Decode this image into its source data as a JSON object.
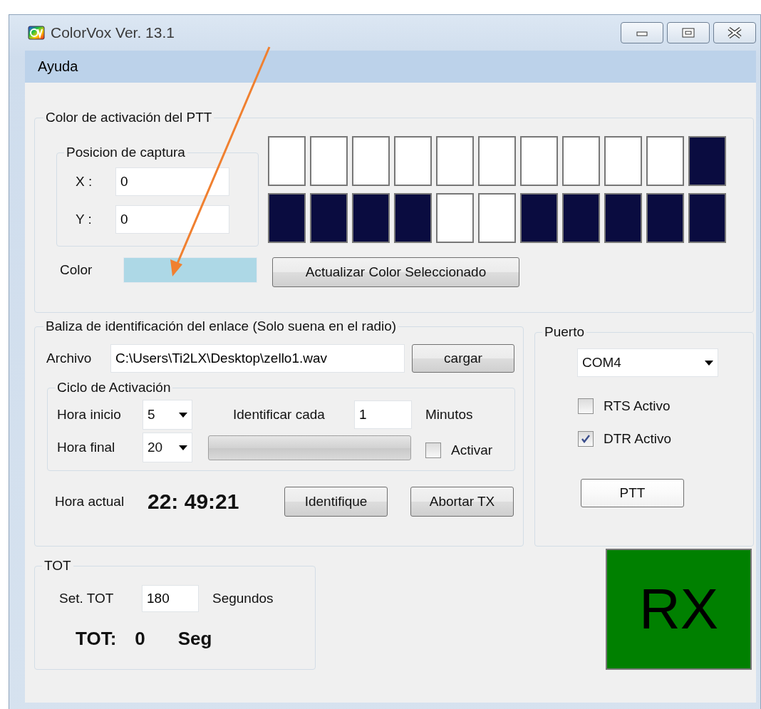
{
  "window": {
    "title": "ColorVox  Ver. 13.1"
  },
  "menu": [
    {
      "label": "Ayuda"
    }
  ],
  "ptt_color": {
    "title": "Color de activación del PTT",
    "capture": {
      "title": "Posicion de captura",
      "fields": [
        {
          "label": "X :",
          "value": "0"
        },
        {
          "label": "Y :",
          "value": "0"
        }
      ]
    },
    "color_label": "Color",
    "color": "#add8e6",
    "swatches": [
      [
        {
          "color": "#ffffff"
        },
        {
          "color": "#ffffff"
        },
        {
          "color": "#ffffff"
        },
        {
          "color": "#ffffff"
        },
        {
          "color": "#ffffff"
        },
        {
          "color": "#ffffff"
        },
        {
          "color": "#ffffff"
        },
        {
          "color": "#ffffff"
        },
        {
          "color": "#ffffff"
        },
        {
          "color": "#ffffff"
        },
        {
          "color": "#0a0c40"
        }
      ],
      [
        {
          "color": "#0a0c40"
        },
        {
          "color": "#0a0c40"
        },
        {
          "color": "#0a0c40"
        },
        {
          "color": "#0a0c40"
        },
        {
          "color": "#ffffff"
        },
        {
          "color": "#ffffff"
        },
        {
          "color": "#0a0c40"
        },
        {
          "color": "#0a0c40"
        },
        {
          "color": "#0a0c40"
        },
        {
          "color": "#0a0c40"
        },
        {
          "color": "#0a0c40"
        }
      ]
    ],
    "update_button": "Actualizar Color Seleccionado"
  },
  "beacon": {
    "title": "Baliza de identificación del enlace (Solo suena en el radio)",
    "file_label": "Archivo",
    "file_value": "C:\\Users\\Ti2LX\\Desktop\\zello1.wav",
    "load_button": "cargar",
    "cycle": {
      "title": "Ciclo de Activación",
      "start_label": "Hora inicio",
      "start_value": "5",
      "end_label": "Hora final",
      "end_value": "20",
      "every_label": "Identificar cada",
      "every_value": "1",
      "unit": "Minutos",
      "progress": {
        "level": 0
      },
      "activate": {
        "label": "Activar",
        "checked": false
      }
    },
    "time_label": "Hora actual",
    "time": "22: 49:21",
    "buttons": [
      "Identifique",
      "Abortar TX"
    ]
  },
  "port": {
    "title": "Puerto",
    "value": "COM4",
    "checkboxes": [
      {
        "label": "RTS Activo",
        "checked": false
      },
      {
        "label": "DTR Activo",
        "checked": true
      }
    ],
    "ptt_button": "PTT"
  },
  "tot": {
    "title": "TOT",
    "set_label": "Set. TOT",
    "set_value": "180",
    "unit": "Segundos",
    "status_label": "TOT:",
    "status_value": "0",
    "status_unit": "Seg"
  },
  "status": {
    "label": "RX"
  }
}
